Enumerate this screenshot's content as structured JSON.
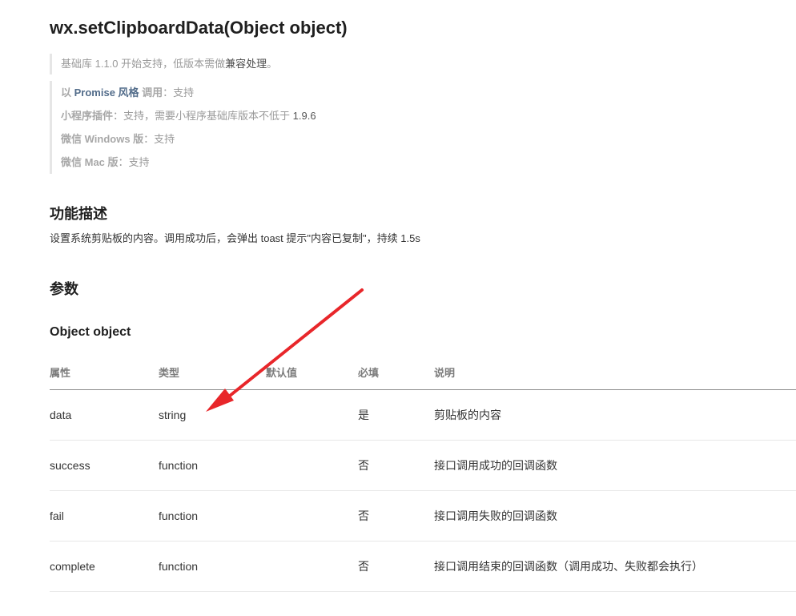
{
  "header": {
    "title": "wx.setClipboardData(Object object)"
  },
  "notice": {
    "prefix": "基础库 1.1.0 开始支持，低版本需做",
    "link": "兼容处理",
    "suffix": "。"
  },
  "support": {
    "promise_label_prefix": "以 ",
    "promise_label_hl": "Promise 风格",
    "promise_label_suffix": " 调用",
    "promise_value": "：支持",
    "plugin_label": "小程序插件",
    "plugin_value": "：支持，需要小程序基础库版本不低于 ",
    "plugin_version": "1.9.6",
    "windows_label": "微信 Windows 版",
    "windows_value": "：支持",
    "mac_label": "微信 Mac 版",
    "mac_value": "：支持"
  },
  "sections": {
    "description_title": "功能描述",
    "description_text": "设置系统剪贴板的内容。调用成功后，会弹出 toast 提示\"内容已复制\"，持续 1.5s",
    "params_title": "参数",
    "object_title": "Object object"
  },
  "table": {
    "headers": [
      "属性",
      "类型",
      "默认值",
      "必填",
      "说明"
    ],
    "rows": [
      {
        "name": "data",
        "type": "string",
        "default": "",
        "required": "是",
        "desc": "剪贴板的内容"
      },
      {
        "name": "success",
        "type": "function",
        "default": "",
        "required": "否",
        "desc": "接口调用成功的回调函数"
      },
      {
        "name": "fail",
        "type": "function",
        "default": "",
        "required": "否",
        "desc": "接口调用失败的回调函数"
      },
      {
        "name": "complete",
        "type": "function",
        "default": "",
        "required": "否",
        "desc": "接口调用结束的回调函数（调用成功、失败都会执行）"
      }
    ]
  },
  "colors": {
    "annotation_arrow": "#e8262a",
    "link": "#526c8a"
  }
}
